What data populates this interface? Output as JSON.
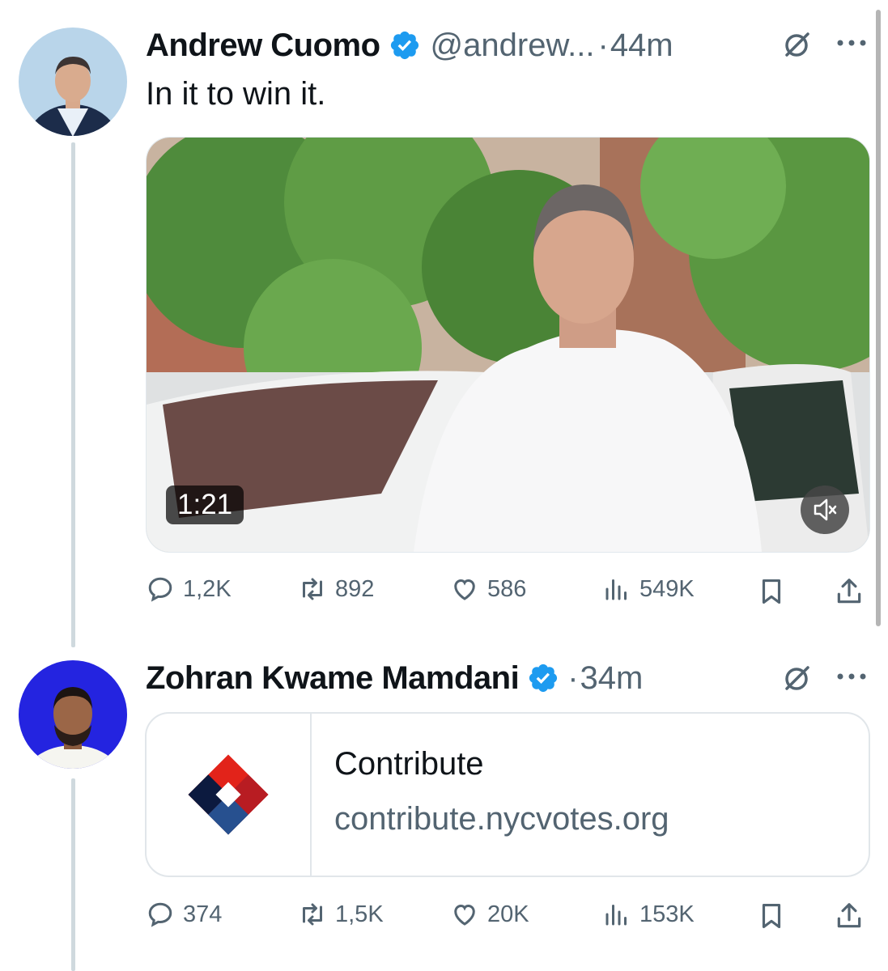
{
  "tweets": [
    {
      "author": "Andrew Cuomo",
      "handle": "@andrew...",
      "time_sep": "·",
      "time": "44m",
      "text": "In it to win it.",
      "video_duration": "1:21",
      "actions": {
        "replies": "1,2K",
        "reposts": "892",
        "likes": "586",
        "views": "549K"
      }
    },
    {
      "author": "Zohran Kwame Mamdani",
      "time_sep": "·",
      "time": "34m",
      "card": {
        "title": "Contribute",
        "domain": "contribute.nycvotes.org"
      },
      "actions": {
        "replies": "374",
        "reposts": "1,5K",
        "likes": "20K",
        "views": "153K"
      }
    }
  ],
  "colors": {
    "verified": "#1d9bf0",
    "secondary_text": "#536471",
    "thread_line": "#cfd9de"
  },
  "icons": [
    "verified-badge-icon",
    "grok-icon",
    "more-icon",
    "mute-icon",
    "reply-icon",
    "repost-icon",
    "like-icon",
    "views-icon",
    "bookmark-icon",
    "share-icon",
    "logo-icon"
  ]
}
